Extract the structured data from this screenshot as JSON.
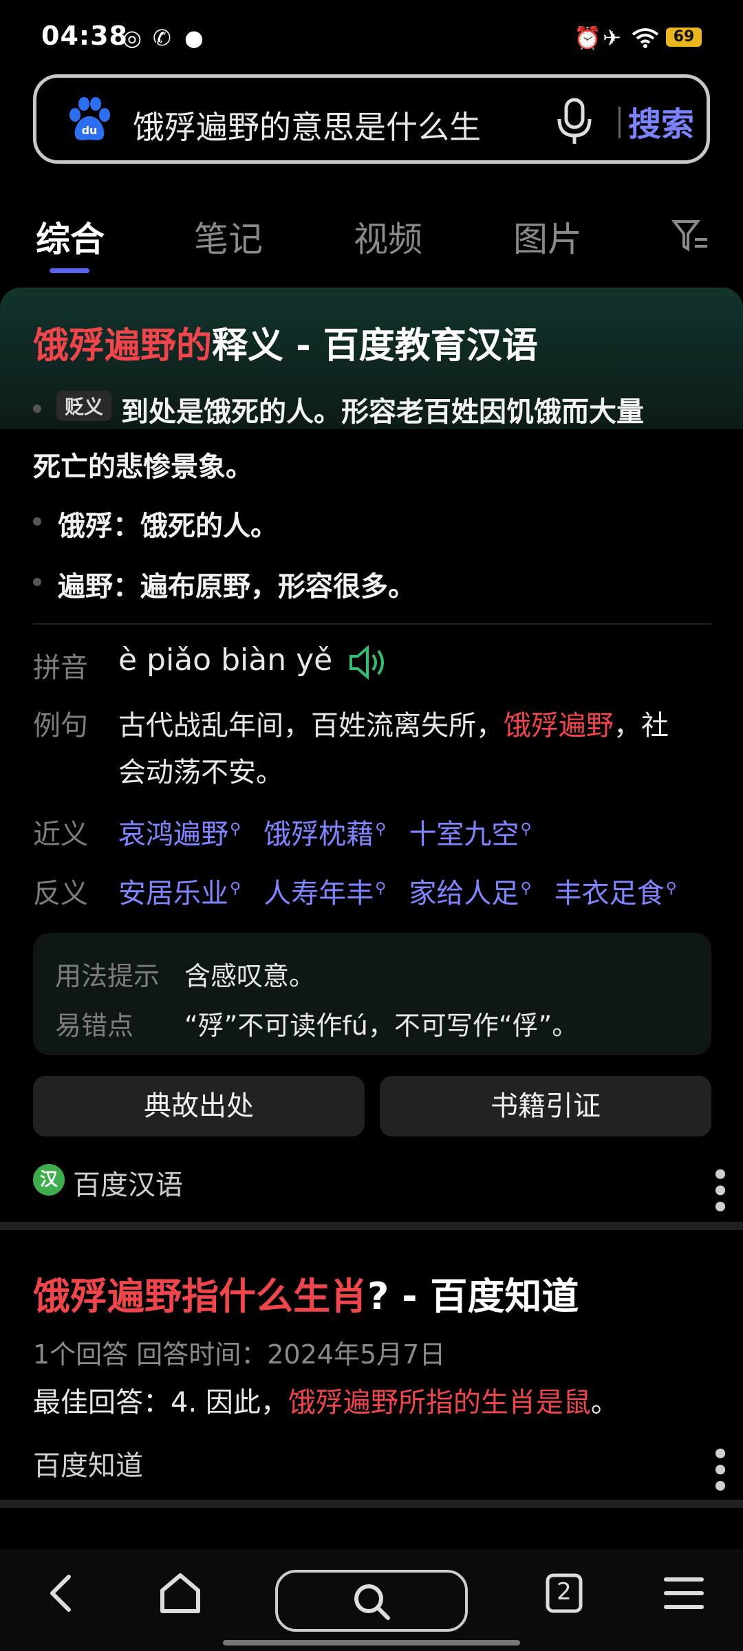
{
  "status_bar": {
    "time": "04:38",
    "battery": "69",
    "icons": [
      "target-icon",
      "phone-wifi-icon",
      "message-icon",
      "alarm-icon",
      "airplane-icon",
      "wifi-icon"
    ]
  },
  "search": {
    "query": "饿殍遍野的意思是什么生",
    "button_label": "搜索",
    "logo": "baidu-paw-logo"
  },
  "tabs": [
    {
      "label": "综合",
      "active": true
    },
    {
      "label": "笔记"
    },
    {
      "label": "视频"
    },
    {
      "label": "图片"
    }
  ],
  "result1": {
    "title_highlight": "饿殍遍野的",
    "title_rest": "释义 - 百度教育汉语",
    "badge": "贬义",
    "definition_line1": "到处是饿死的人。形容老百姓因饥饿而大量",
    "definition_line2": "死亡的悲惨景象。",
    "items": [
      "饿殍：饿死的人。",
      "遍野：遍布原野，形容很多。"
    ],
    "pinyin_label": "拼音",
    "pinyin": "è piǎo biàn yě",
    "example_label": "例句",
    "example_before": "古代战乱年间，百姓流离失所，",
    "example_highlight": "饿殍遍野",
    "example_after": "，社",
    "example_line2": "会动荡不安。",
    "synonym_label": "近义",
    "synonyms": [
      "哀鸿遍野",
      "饿殍枕藉",
      "十室九空"
    ],
    "antonym_label": "反义",
    "antonyms": [
      "安居乐业",
      "人寿年丰",
      "家给人足",
      "丰衣足食"
    ],
    "usage_label": "用法提示",
    "usage": "含感叹意。",
    "mistake_label": "易错点",
    "mistake": "“殍”不可读作fú，不可写作“俘”。",
    "buttons": [
      "典故出处",
      "书籍引证"
    ],
    "source_name": "百度汉语"
  },
  "result2": {
    "title_highlight": "饿殍遍野指什么生肖",
    "title_rest": "? - 百度知道",
    "meta": "1个回答   回答时间：2024年5月7日",
    "best_prefix": "最佳回答：4. 因此，",
    "best_highlight": "饿殍遍野所指的生肖是鼠",
    "best_suffix": "。",
    "source_name": "百度知道"
  },
  "bottom_nav": {
    "tab_count": "2"
  }
}
